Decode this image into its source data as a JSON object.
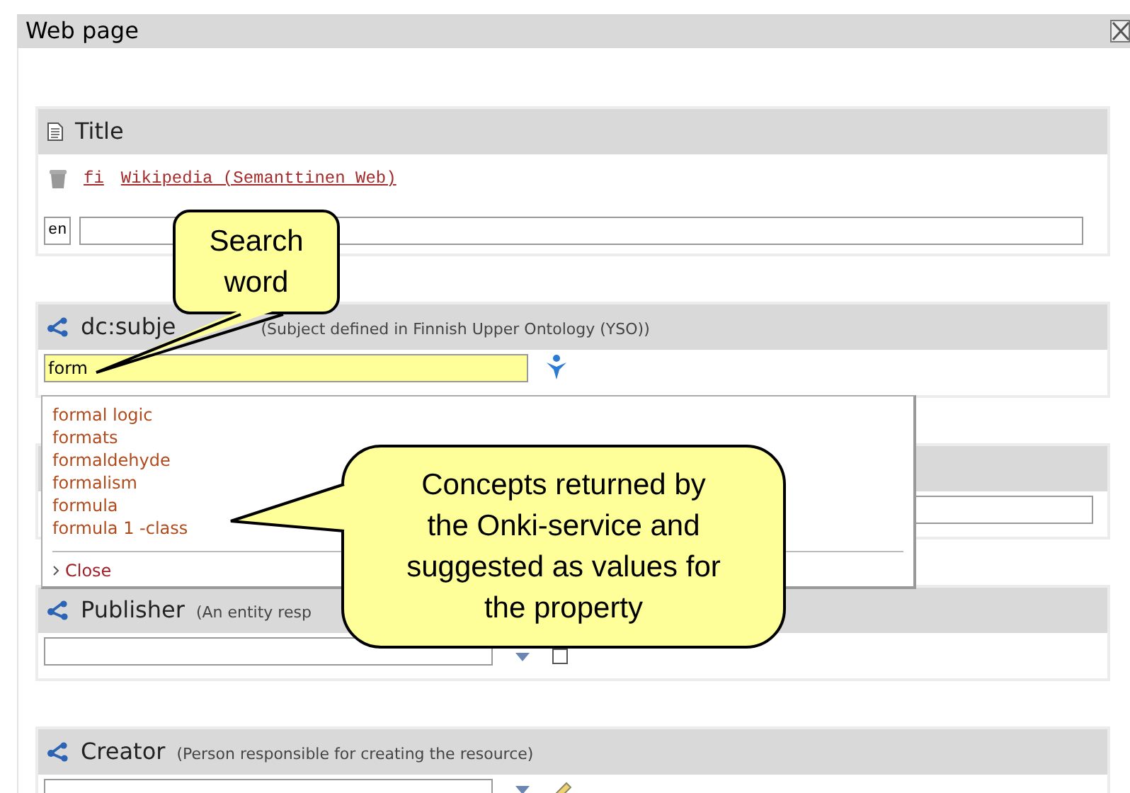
{
  "window": {
    "title": "Web page"
  },
  "sections": [
    {
      "kind": "literal",
      "label": "Title",
      "values": [
        {
          "lang": "fi",
          "text": "Wikipedia (Semanttinen Web)"
        }
      ],
      "new_lang": "en"
    },
    {
      "kind": "concept",
      "label": "dc:subje",
      "description": "(Subject defined in Finnish Upper Ontology (YSO))",
      "value": "form",
      "active": true,
      "control": {
        "kind": "search"
      }
    },
    {
      "kind": "concept",
      "active": false
    },
    {
      "kind": "concept",
      "label": "Publisher",
      "description": "(An entity resp",
      "active": false,
      "control": {
        "kind": "checkbox",
        "checked": false
      }
    },
    {
      "kind": "concept",
      "label": "Creator",
      "description": "(Person responsible for creating the resource)",
      "active": false,
      "control": {
        "kind": "edit"
      }
    }
  ],
  "suggestions": {
    "items": [
      "formal logic",
      "formats",
      "formaldehyde",
      "formalism",
      "formula",
      "formula 1 -class"
    ],
    "close": "Close"
  },
  "callouts": [
    {
      "kind": "small",
      "lines": [
        "Search",
        "word"
      ]
    },
    {
      "kind": "large",
      "lines": [
        "Concepts returned by",
        "the Onki-service and",
        "suggested as values for",
        "the property"
      ]
    }
  ]
}
